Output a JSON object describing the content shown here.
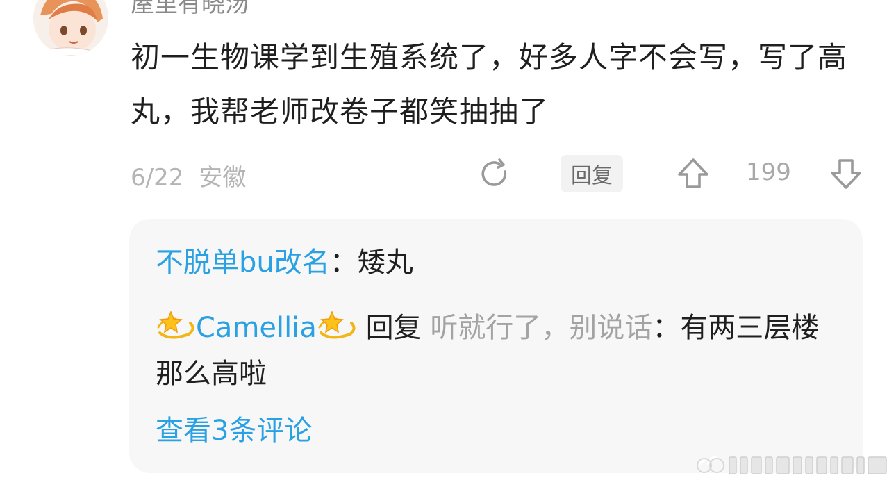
{
  "post": {
    "username": "屋里有晓汤",
    "text": "初一生物课学到生殖系统了，好多人字不会写，写了高丸，我帮老师改卷子都笑抽抽了",
    "date": "6/22",
    "location": "安徽",
    "reply_label": "回复",
    "vote_count": "199",
    "icons": {
      "share": "refresh-share-icon",
      "upvote": "thumb-up-arrow-icon",
      "downvote": "thumb-down-arrow-icon"
    }
  },
  "replies": {
    "items": [
      {
        "author": "不脱单bu改名",
        "separator": "：",
        "text": "矮丸"
      },
      {
        "author": "Camellia",
        "author_emoji": "dizzy-star-emoji",
        "reply_word": " 回复 ",
        "reply_to": "听就行了，别说话",
        "separator": "：",
        "text": "有两三层楼那么高啦"
      }
    ],
    "view_more": "查看3条评论"
  },
  "colors": {
    "link_blue": "#2aa1e3",
    "meta_gray": "#b4b4b4",
    "box_bg": "#f7f7f7"
  }
}
